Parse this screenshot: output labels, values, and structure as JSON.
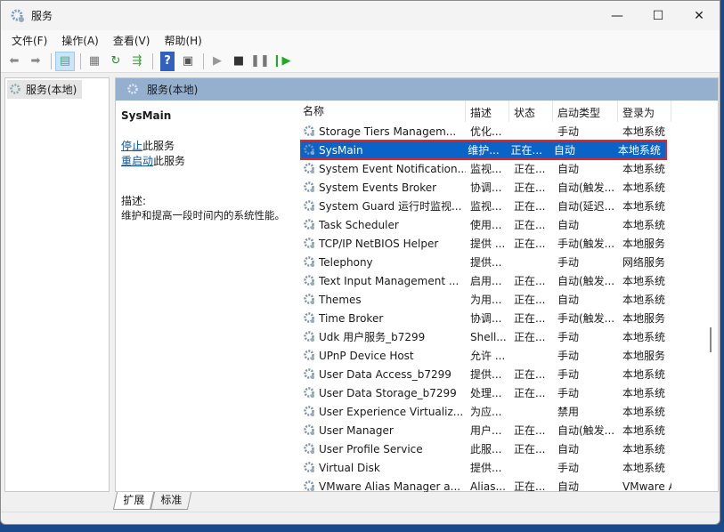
{
  "window": {
    "title": "服务",
    "minimize": "—",
    "maximize": "☐",
    "close": "✕"
  },
  "menu": [
    "文件(F)",
    "操作(A)",
    "查看(V)",
    "帮助(H)"
  ],
  "tree": {
    "root": "服务(本地)"
  },
  "pane": {
    "header": "服务(本地)"
  },
  "detail": {
    "service_name": "SysMain",
    "stop_link": "停止",
    "stop_suffix": "此服务",
    "restart_link": "重启动",
    "restart_suffix": "此服务",
    "desc_label": "描述:",
    "desc_text": "维护和提高一段时间内的系统性能。"
  },
  "columns": [
    "名称",
    "描述",
    "状态",
    "启动类型",
    "登录为"
  ],
  "rows": [
    [
      "Storage Tiers Managem...",
      "优化...",
      "",
      "手动",
      "本地系统"
    ],
    [
      "SysMain",
      "维护...",
      "正在...",
      "自动",
      "本地系统"
    ],
    [
      "System Event Notification...",
      "监视...",
      "正在...",
      "自动",
      "本地系统"
    ],
    [
      "System Events Broker",
      "协调...",
      "正在...",
      "自动(触发...",
      "本地系统"
    ],
    [
      "System Guard 运行时监视...",
      "监视...",
      "正在...",
      "自动(延迟...",
      "本地系统"
    ],
    [
      "Task Scheduler",
      "使用...",
      "正在...",
      "自动",
      "本地系统"
    ],
    [
      "TCP/IP NetBIOS Helper",
      "提供 ...",
      "正在...",
      "手动(触发...",
      "本地服务"
    ],
    [
      "Telephony",
      "提供...",
      "",
      "手动",
      "网络服务"
    ],
    [
      "Text Input Management ...",
      "启用...",
      "正在...",
      "自动(触发...",
      "本地系统"
    ],
    [
      "Themes",
      "为用...",
      "正在...",
      "自动",
      "本地系统"
    ],
    [
      "Time Broker",
      "协调...",
      "正在...",
      "手动(触发...",
      "本地服务"
    ],
    [
      "Udk 用户服务_b7299",
      "Shell...",
      "正在...",
      "手动",
      "本地系统"
    ],
    [
      "UPnP Device Host",
      "允许 ...",
      "",
      "手动",
      "本地服务"
    ],
    [
      "User Data Access_b7299",
      "提供...",
      "正在...",
      "手动",
      "本地系统"
    ],
    [
      "User Data Storage_b7299",
      "处理...",
      "正在...",
      "手动",
      "本地系统"
    ],
    [
      "User Experience Virtualiz...",
      "为应...",
      "",
      "禁用",
      "本地系统"
    ],
    [
      "User Manager",
      "用户...",
      "正在...",
      "自动(触发...",
      "本地系统"
    ],
    [
      "User Profile Service",
      "此服...",
      "正在...",
      "自动",
      "本地系统"
    ],
    [
      "Virtual Disk",
      "提供...",
      "",
      "手动",
      "本地系统"
    ],
    [
      "VMware Alias Manager a...",
      "Alias...",
      "正在...",
      "自动",
      "VMware Alias Manager a..."
    ]
  ],
  "selected_index": 1,
  "tabs": [
    "扩展",
    "标准"
  ]
}
